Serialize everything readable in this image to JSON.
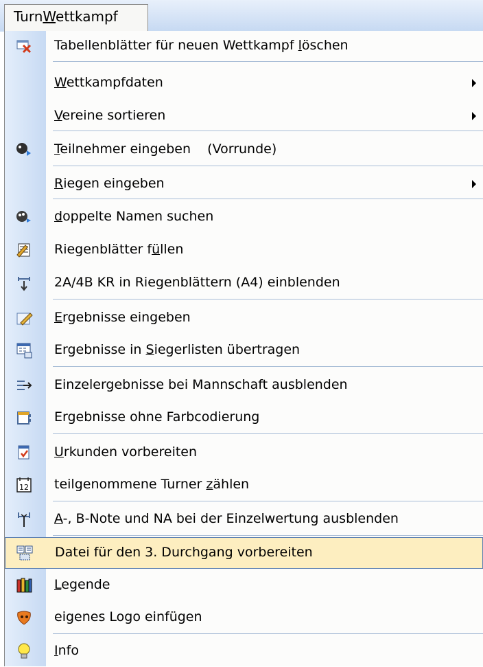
{
  "menu": {
    "title_pre": "Turn",
    "title_u": "W",
    "title_post": "ettkampf"
  },
  "items": [
    {
      "pre": "Tabellenblätter für neuen Wettkampf ",
      "u": "l",
      "post": "öschen",
      "icon": "delete-sheets-icon"
    },
    {
      "pre": "",
      "u": "W",
      "post": "ettkampfdaten",
      "icon": "",
      "submenu": true
    },
    {
      "pre": "",
      "u": "V",
      "post": "ereine sortieren",
      "icon": "",
      "submenu": true
    },
    {
      "pre": "",
      "u": "T",
      "post": "eilnehmer eingeben    (Vorrunde)",
      "icon": "participants-icon"
    },
    {
      "pre": "",
      "u": "R",
      "post": "iegen eingeben",
      "icon": "",
      "submenu": true
    },
    {
      "pre": "",
      "u": "d",
      "post": "oppelte Namen suchen",
      "icon": "find-duplicates-icon"
    },
    {
      "pre": "Riegenblätter f",
      "u": "ü",
      "post": "llen",
      "icon": "fill-sheets-icon"
    },
    {
      "pre": "2A/4B KR in Riegenblättern (A4) einblenden",
      "u": "",
      "post": "",
      "icon": "show-columns-icon"
    },
    {
      "pre": "",
      "u": "E",
      "post": "rgebnisse eingeben",
      "icon": "edit-results-icon"
    },
    {
      "pre": "Ergebnisse in ",
      "u": "S",
      "post": "iegerlisten übertragen",
      "icon": "transfer-icon"
    },
    {
      "pre": "Einzelergebnisse bei Mannschaft ausblenden",
      "u": "",
      "post": "",
      "icon": "hide-arrow-icon"
    },
    {
      "pre": "Ergebnisse ohne Farbcodierung",
      "u": "",
      "post": "",
      "icon": "no-color-icon"
    },
    {
      "pre": "",
      "u": "U",
      "post": "rkunden vorbereiten",
      "icon": "certificate-icon"
    },
    {
      "pre": "teilgenommene Turner ",
      "u": "z",
      "post": "ählen",
      "icon": "calendar-12-icon"
    },
    {
      "pre": "",
      "u": "A",
      "post": "-, B-Note und NA bei der Einzelwertung ausblenden",
      "icon": "hide-notes-icon"
    },
    {
      "pre": "Datei für den 3. Durchgang vorbereiten",
      "u": "",
      "post": "",
      "icon": "prepare-file-icon",
      "highlighted": true
    },
    {
      "pre": "",
      "u": "L",
      "post": "egende",
      "icon": "legend-books-icon"
    },
    {
      "pre": "eigenes Logo einfügen",
      "u": "",
      "post": "",
      "icon": "logo-insert-icon"
    },
    {
      "pre": "",
      "u": "I",
      "post": "nfo",
      "icon": "info-bulb-icon"
    }
  ]
}
